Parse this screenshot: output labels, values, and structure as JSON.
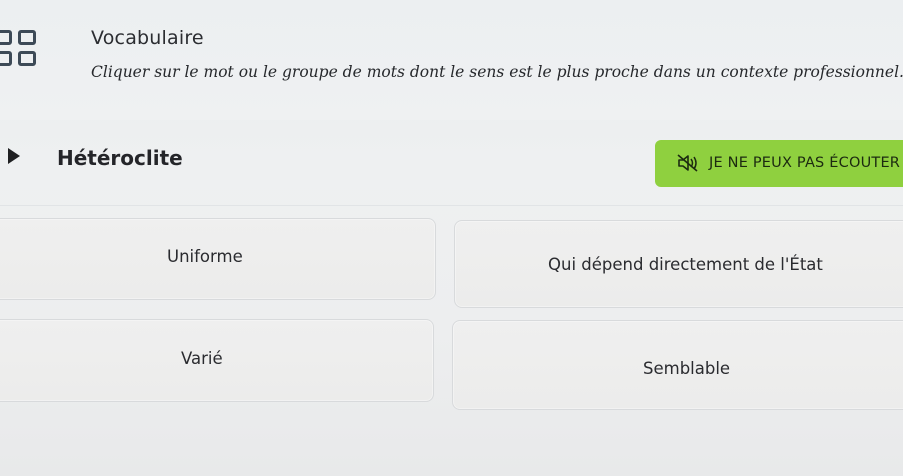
{
  "exercise": {
    "title": "Vocabulaire",
    "instruction": "Cliquer sur le mot ou le groupe de mots dont le sens est le plus proche dans un contexte professionnel."
  },
  "question": {
    "word": "Hétéroclite"
  },
  "listen_button": {
    "label": "JE NE PEUX PAS ÉCOUTER",
    "icon": "speaker-muted-icon",
    "color": "#8fd03f"
  },
  "options": [
    {
      "label": "Uniforme"
    },
    {
      "label": "Qui dépend directement de l'État"
    },
    {
      "label": "Varié"
    },
    {
      "label": "Semblable"
    }
  ]
}
